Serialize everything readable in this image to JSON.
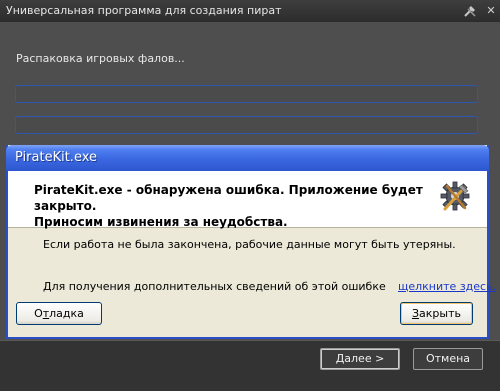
{
  "background_window": {
    "title": "Универсальная программа для создания пират",
    "status_text": "Распаковка игровых фалов...",
    "progress": [
      0,
      0
    ],
    "buttons": {
      "next": {
        "underlined": "Д",
        "rest": "алее",
        "arrow": ">"
      },
      "cancel": "Отмена"
    },
    "icons": [
      "wrench-hammer-icon",
      "close-icon"
    ]
  },
  "error_dialog": {
    "title": "PirateKit.exe",
    "heading": "PirateKit.exe - обнаружена ошибка. Приложение будет закрыто.\nПриносим извинения за неудобства.",
    "info_line_1": "Если работа не была закончена, рабочие данные могут быть утеряны.",
    "info_line_2": "Для получения дополнительных сведений об этой ошибке",
    "link_text": "щелкните здесь.",
    "buttons": {
      "debug": {
        "prefix": "О",
        "underlined": "т",
        "rest": "ладка"
      },
      "close": {
        "underlined": "З",
        "rest": "акрыть"
      }
    },
    "icons": [
      "gear-tools-icon"
    ],
    "colors": {
      "title_bar": "#2d57cf",
      "link": "#1a38c9"
    }
  }
}
